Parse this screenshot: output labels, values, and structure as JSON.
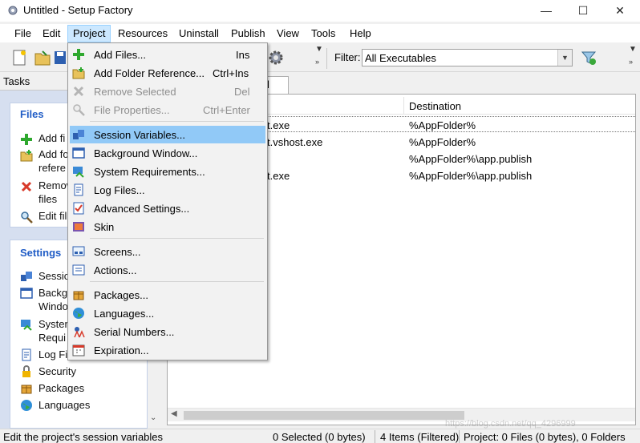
{
  "window": {
    "title": "Untitled - Setup Factory"
  },
  "menu": [
    "File",
    "Edit",
    "Project",
    "Resources",
    "Uninstall",
    "Publish",
    "View",
    "Tools",
    "Help"
  ],
  "toolbar": {
    "filter_label": "Filter:",
    "filter_value": "All Executables"
  },
  "tasks": {
    "header": "Tasks",
    "files": {
      "title": "Files",
      "items": [
        "Add fi",
        "Add fo",
        "refere",
        "Remov",
        "files",
        "Edit fil"
      ]
    },
    "settings": {
      "title": "Settings",
      "items": [
        "Sessic",
        "Backg",
        "Windo",
        "Syster",
        "Requi",
        "Log Fi",
        "Security",
        "Packages",
        "Languages"
      ]
    }
  },
  "content": {
    "tab": "ernal",
    "columns": {
      "destination": "Destination"
    },
    "rows": [
      {
        "file": "t.exe",
        "destination": "%AppFolder%"
      },
      {
        "file": "t.vshost.exe",
        "destination": "%AppFolder%"
      },
      {
        "file": "",
        "destination": "%AppFolder%\\app.publish"
      },
      {
        "file": "t.exe",
        "destination": "%AppFolder%\\app.publish"
      }
    ]
  },
  "project_menu": {
    "items": [
      {
        "label": "Add Files...",
        "shortcut": "Ins",
        "icon": "add-icon"
      },
      {
        "label": "Add Folder Reference...",
        "shortcut": "Ctrl+Ins",
        "icon": "folder-add-icon"
      },
      {
        "label": "Remove Selected",
        "shortcut": "Del",
        "icon": "remove-icon"
      },
      {
        "label": "File Properties...",
        "shortcut": "Ctrl+Enter",
        "icon": "magnifier-icon"
      },
      {
        "label": "Session Variables...",
        "shortcut": "",
        "icon": "session-variables-icon"
      },
      {
        "label": "Background Window...",
        "shortcut": "",
        "icon": "window-icon"
      },
      {
        "label": "System Requirements...",
        "shortcut": "",
        "icon": "system-requirements-icon"
      },
      {
        "label": "Log Files...",
        "shortcut": "",
        "icon": "log-file-icon"
      },
      {
        "label": "Advanced Settings...",
        "shortcut": "",
        "icon": "checklist-icon"
      },
      {
        "label": "Skin",
        "shortcut": "",
        "icon": "skin-icon"
      },
      {
        "label": "Screens...",
        "shortcut": "",
        "icon": "screens-icon"
      },
      {
        "label": "Actions...",
        "shortcut": "",
        "icon": "actions-icon"
      },
      {
        "label": "Packages...",
        "shortcut": "",
        "icon": "package-icon"
      },
      {
        "label": "Languages...",
        "shortcut": "",
        "icon": "globe-icon"
      },
      {
        "label": "Serial Numbers...",
        "shortcut": "",
        "icon": "serial-icon"
      },
      {
        "label": "Expiration...",
        "shortcut": "",
        "icon": "calendar-icon"
      }
    ]
  },
  "status": {
    "hint": "Edit the project's session variables",
    "selected": "0 Selected (0 bytes)",
    "items": "4 Items (Filtered)",
    "project": "Project: 0 Files (0 bytes), 0 Folders"
  },
  "watermark": "https://blog.csdn.net/qq_4296999"
}
